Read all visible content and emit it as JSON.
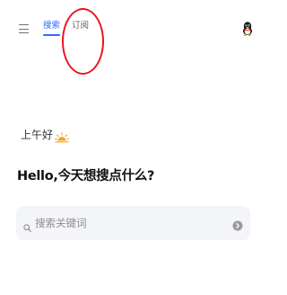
{
  "nav": {
    "tabs": [
      {
        "label": "搜索",
        "active": true
      },
      {
        "label": "订阅",
        "active": false
      }
    ],
    "menu_icon": "hamburger-menu-icon",
    "profile_icon": "penguin-avatar-icon"
  },
  "greeting": {
    "text": "上午好",
    "icon": "sunrise-icon"
  },
  "headline": "Hello,今天想搜点什么?",
  "search": {
    "placeholder": "搜索关键词",
    "icon": "search-icon",
    "submit_icon": "arrow-right-circle-icon"
  },
  "colors": {
    "accent": "#2f6bff",
    "annotation": "#e8161c",
    "sun": "#f5a623",
    "search_bg": "#f4f5f8"
  }
}
